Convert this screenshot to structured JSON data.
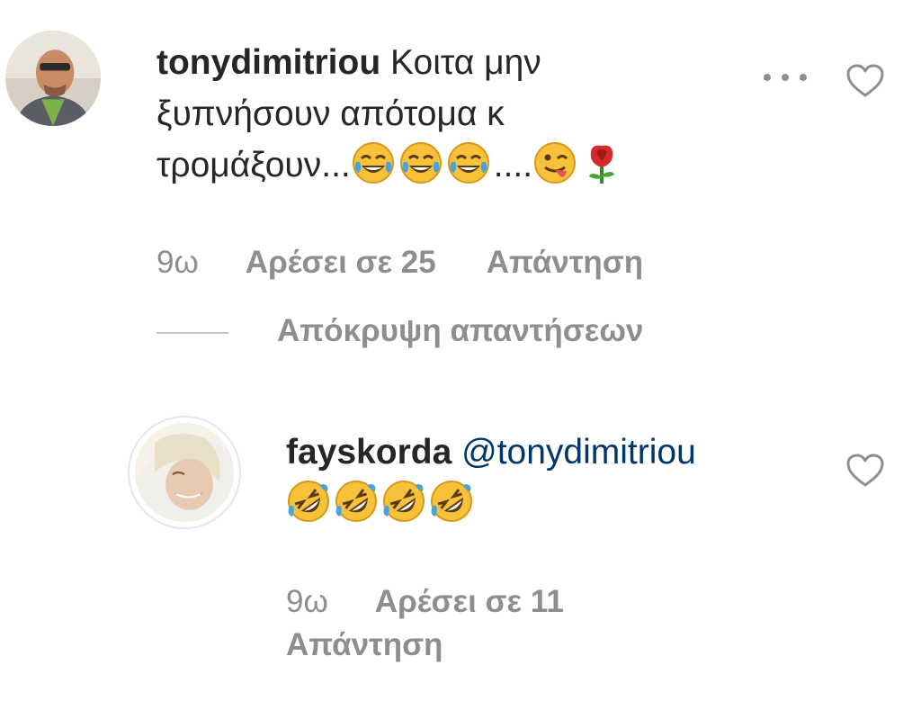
{
  "comments": [
    {
      "username": "tonydimitriou",
      "text_line1": "Κοιτα μην",
      "text_line2": "ξυπνήσουν απότομα κ",
      "text_line3_prefix": "τρομάξουν...",
      "text_line3_mid": "....",
      "emojis": [
        "face-with-tears-of-joy-icon",
        "face-with-tears-of-joy-icon",
        "face-with-tears-of-joy-icon",
        "winking-face-with-tongue-icon",
        "rose-icon"
      ],
      "time": "9ω",
      "likes": "Αρέσει σε 25",
      "reply": "Απάντηση",
      "hide_replies": "Απόκρυψη απαντήσεων"
    },
    {
      "username": "fayskorda",
      "mention": "@tonydimitriou",
      "emojis": [
        "rolling-on-floor-laughing-icon",
        "rolling-on-floor-laughing-icon",
        "rolling-on-floor-laughing-icon",
        "rolling-on-floor-laughing-icon"
      ],
      "time": "9ω",
      "likes": "Αρέσει σε 11",
      "reply": "Απάντηση"
    }
  ],
  "colors": {
    "text": "#262626",
    "secondary": "#8e8e8e",
    "mention": "#00376b",
    "divider": "#c7c7c7"
  }
}
